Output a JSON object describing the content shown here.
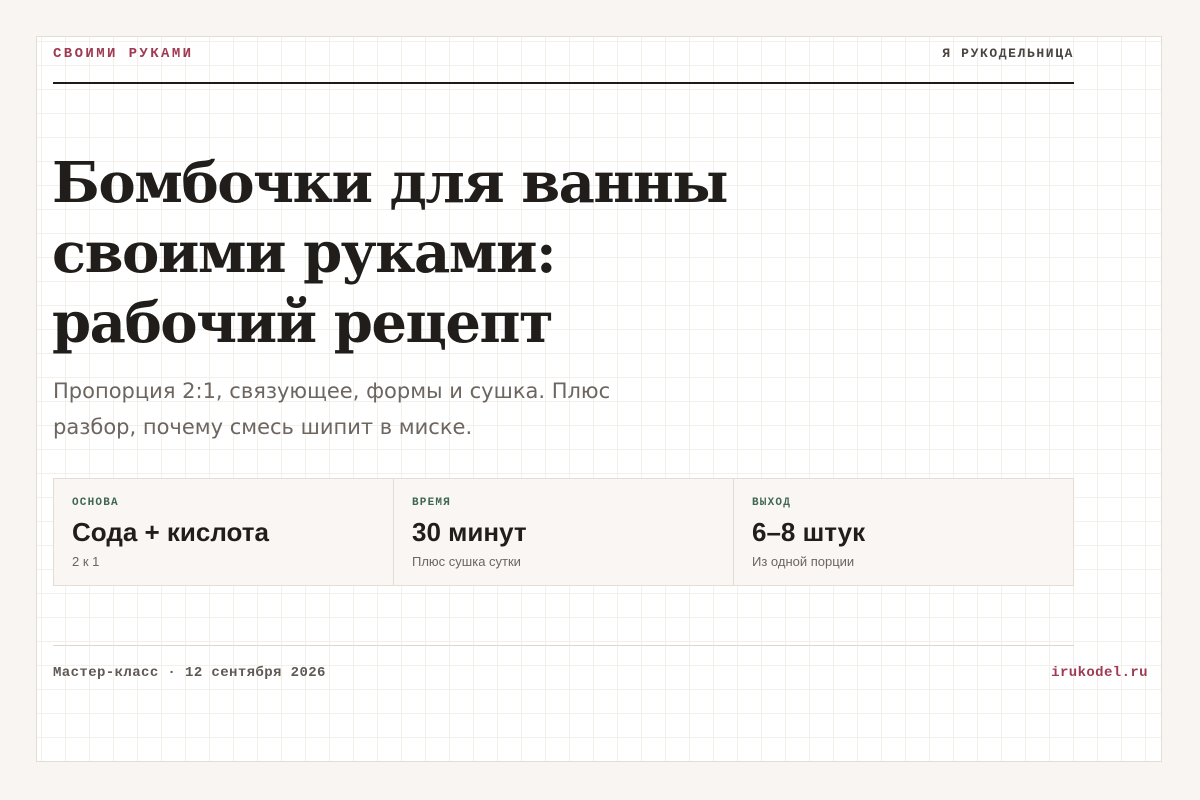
{
  "header": {
    "kicker": "СВОИМИ РУКАМИ",
    "brand": "Я РУКОДЕЛЬНИЦА"
  },
  "article": {
    "title_lines": [
      "Бомбочки для ванны",
      "своими руками:",
      "рабочий рецепт"
    ],
    "subtitle_lines": [
      "Пропорция 2:1, связующее, формы и сушка. Плюс",
      "разбор, почему смесь шипит в миске."
    ]
  },
  "facts": [
    {
      "label": "ОСНОВА",
      "value": "Сода + кислота",
      "note": "2 к 1"
    },
    {
      "label": "ВРЕМЯ",
      "value": "30 минут",
      "note": "Плюс сушка сутки"
    },
    {
      "label": "ВЫХОД",
      "value": "6–8 штук",
      "note": "Из одной порции"
    }
  ],
  "footer": {
    "meta": "Мастер-класс · 12 сентября 2026",
    "site": "irukodel.ru"
  },
  "colors": {
    "accent": "#9e3b52",
    "label_green": "#3f6650",
    "ink": "#211d1b",
    "background": "#f8f5f2"
  }
}
